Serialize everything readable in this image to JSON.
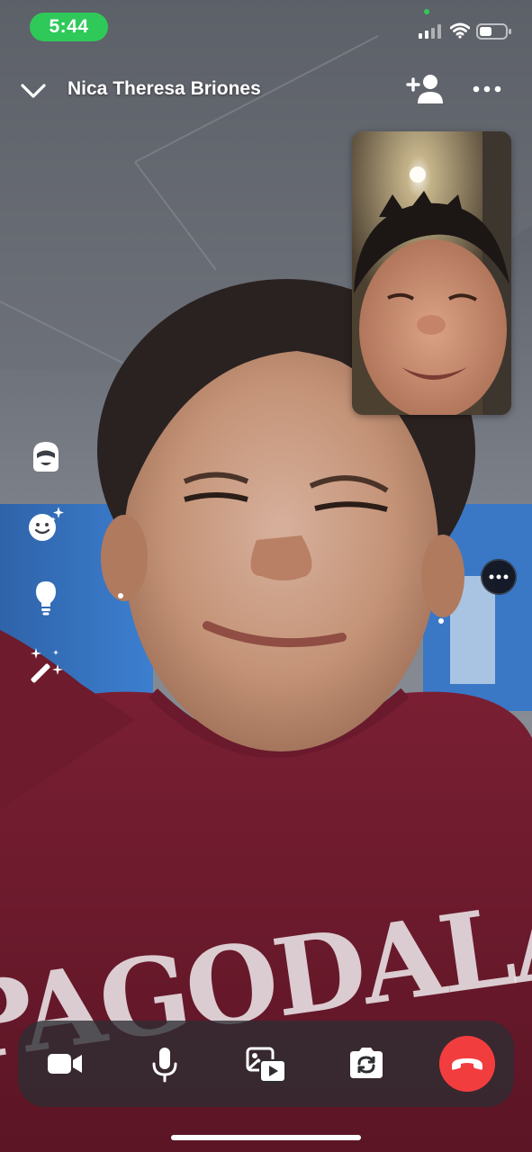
{
  "status_bar": {
    "time": "5:44",
    "icons": [
      "signal-icon",
      "wifi-icon",
      "battery-icon"
    ]
  },
  "header": {
    "back_icon": "chevron-down-icon",
    "caller_name": "Nica Theresa Briones",
    "actions": [
      "add-person-icon",
      "more-icon"
    ]
  },
  "call_view": {
    "remote_video": "remote-participant-video",
    "self_view": "self-view-video",
    "shirt_text": "PAGODALA"
  },
  "side_toolbar": {
    "items": [
      "avatar-effect-icon",
      "emoji-sparkle-icon",
      "lightbulb-icon",
      "magic-wand-icon"
    ]
  },
  "controls": {
    "items": [
      "video-camera-icon",
      "microphone-icon",
      "media-share-icon",
      "flip-camera-icon",
      "end-call-icon"
    ],
    "colors": {
      "end_call": "#f23d3f",
      "status_time_pill": "#2fc95a"
    }
  }
}
